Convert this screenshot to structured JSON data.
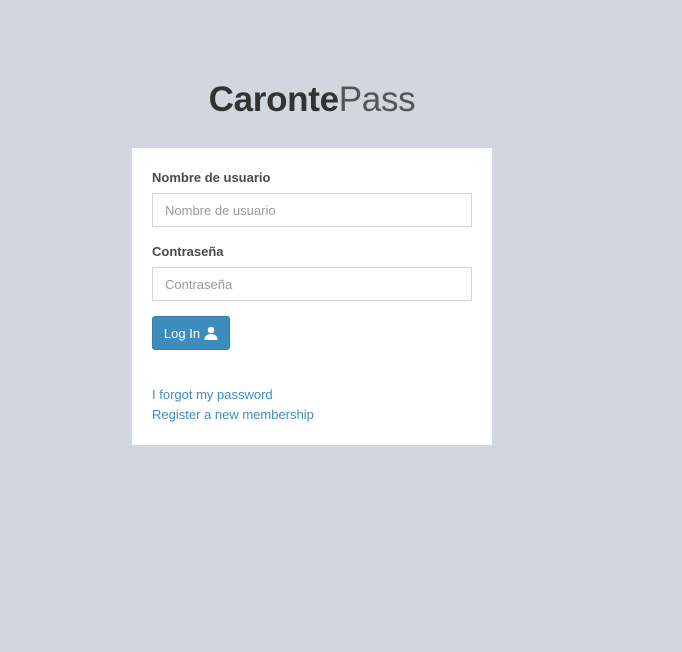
{
  "logo": {
    "bold": "Caronte",
    "light": "Pass"
  },
  "form": {
    "username": {
      "label": "Nombre de usuario",
      "placeholder": "Nombre de usuario",
      "value": ""
    },
    "password": {
      "label": "Contraseña",
      "placeholder": "Contraseña",
      "value": ""
    },
    "submit": {
      "label": "Log In",
      "icon": "user-icon"
    }
  },
  "links": {
    "forgot_password": "I forgot my password",
    "register": "Register a new membership"
  },
  "colors": {
    "background": "#d2d6de",
    "primary": "#3c8dbc",
    "box": "#ffffff"
  }
}
